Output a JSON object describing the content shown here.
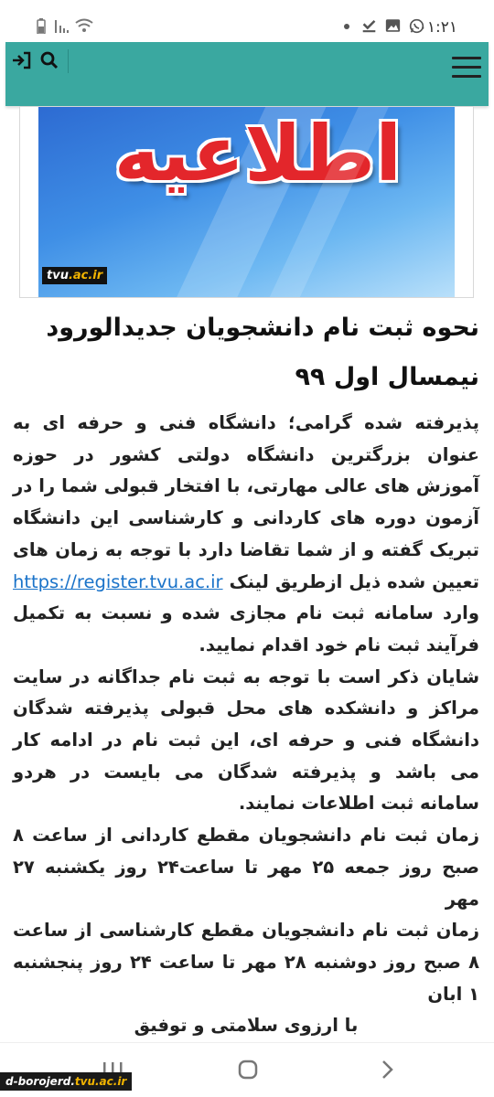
{
  "status_bar": {
    "time": "۰۱:۲۱",
    "icons": [
      "whatsapp-icon",
      "image-icon",
      "download-done-icon",
      "dot-icon",
      "wifi-icon",
      "signal-icon",
      "battery-icon"
    ]
  },
  "header": {
    "login_icon": "login-icon",
    "search_icon": "search-icon",
    "menu_icon": "hamburger-menu-icon",
    "color": "#3aa8a0"
  },
  "banner": {
    "word": "اطلاعیه",
    "brand_prefix": "tvu",
    "brand_suffix": ".ac.ir"
  },
  "article": {
    "title": "نحوه ثبت نام دانشجویان جدیدالورود نیمسال اول ۹۹",
    "p1_part1": "پذیرفته شده گرامی؛ دانشگاه فنی و حرفه ای به عنوان بزرگترین دانشگاه دولتی کشور در حوزه آموزش های عالی مهارتی، با افتخار قبولی شما را در آزمون دوره  های کاردانی و کارشناسی این دانشگاه تبریک گفته و از شما تقاضا دارد با توجه به زمان های تعیین شده ذیل ازطریق لینک",
    "p1_link": "https://register.tvu.ac.ir",
    "p1_part2": "وارد سامانه ثبت نام مجازی شده و نسبت به تکمیل فرآیند ثبت نام خود اقدام نمایید.",
    "p2": "شایان ذکر است با توجه به ثبت نام جداگانه در سایت مراکز و دانشکده های محل قبولی پذیرفته شدگان دانشگاه فنی و حرفه ای، این ثبت نام در ادامه کار می باشد و پذیرفته شدگان می بایست در هردو سامانه ثبت اطلاعات نمایند.",
    "p3": "زمان ثبت نام دانشجویان مقطع کاردانی از ساعت ۸ صبح روز جمعه ۲۵ مهر تا ساعت۲۴ روز یکشنبه ۲۷ مهر",
    "p4": "زمان ثبت نام دانشجویان مقطع کارشناسی  از ساعت ۸ صبح روز دوشنبه ۲۸ مهر تا ساعت ۲۴ روز پنجشنبه ۱ ابان",
    "p5": "با ارزوی سلامتی و توفیق"
  },
  "nav": {
    "recent_icon": "recent-apps-icon",
    "home_icon": "home-icon",
    "back_icon": "back-chevron-icon"
  },
  "watermark": {
    "prefix": "d-borojerd.",
    "suffix": "tvu.ac.ir"
  }
}
